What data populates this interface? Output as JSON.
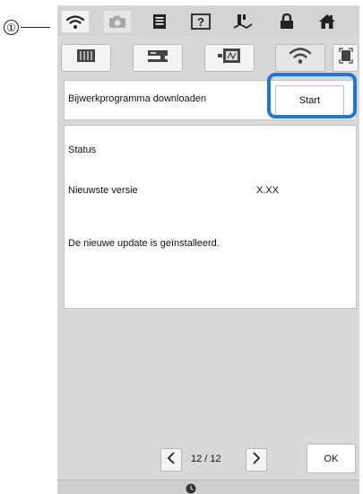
{
  "callout": {
    "number": "①"
  },
  "topbar": {
    "icons": [
      "wifi-icon",
      "camera-icon",
      "document-icon",
      "help-icon",
      "stitch-icon",
      "lock-icon",
      "home-icon"
    ]
  },
  "tabs": {
    "items": [
      "embroidery-frame-icon",
      "machine-icon",
      "card-reader-icon",
      "wifi-icon"
    ],
    "selected": "wifi-icon",
    "right_icon": "screen-capture-icon"
  },
  "download": {
    "label": "Bijwerkprogramma downloaden",
    "start_label": "Start"
  },
  "status": {
    "title": "Status",
    "version_label": "Nieuwste versie",
    "version_value": "X.XX",
    "message": "De nieuwe update is geïnstalleerd."
  },
  "pager": {
    "page_text": "12 / 12",
    "ok_label": "OK"
  },
  "colors": {
    "highlight": "#1d78d6",
    "panel": "#ffffff",
    "background": "#d8d8d8"
  }
}
